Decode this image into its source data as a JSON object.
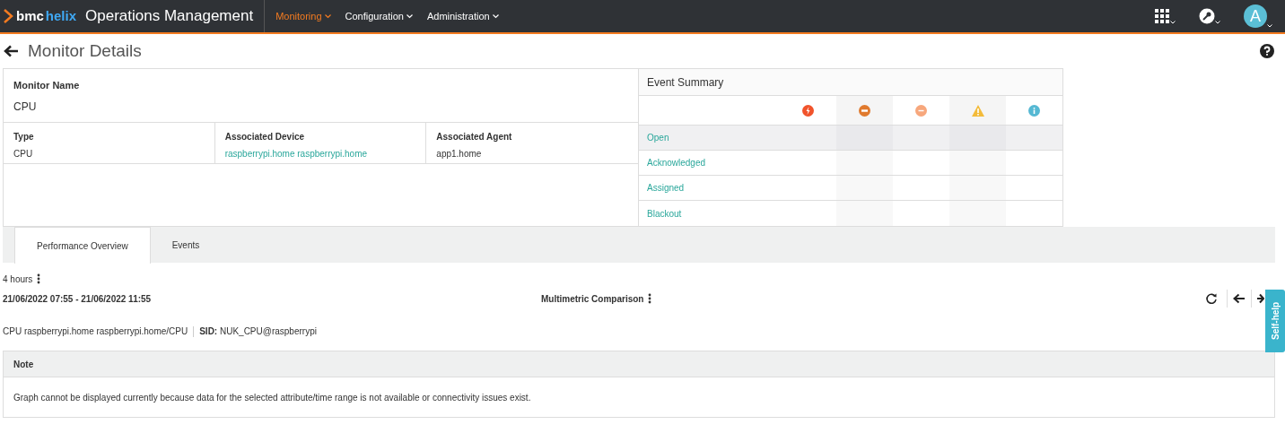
{
  "header": {
    "logo": {
      "brand": "bmc",
      "product": "helix"
    },
    "app_title": "Operations Management",
    "nav": [
      {
        "label": "Monitoring",
        "selected": true
      },
      {
        "label": "Configuration",
        "selected": false
      },
      {
        "label": "Administration",
        "selected": false
      }
    ],
    "avatar": "A"
  },
  "page_title": "Monitor Details",
  "monitor": {
    "name_label": "Monitor Name",
    "name": "CPU",
    "fields": [
      {
        "label": "Type",
        "value": "CPU",
        "kind": "text"
      },
      {
        "label": "Associated Device",
        "value": "raspberrypi.home raspberrypi.home",
        "kind": "link"
      },
      {
        "label": "Associated Agent",
        "value": "app1.home",
        "kind": "text"
      }
    ]
  },
  "event_summary": {
    "title": "Event Summary",
    "severities": [
      {
        "kind": "critical",
        "color": "#f1532b"
      },
      {
        "kind": "major",
        "color": "#e07a2e"
      },
      {
        "kind": "minor",
        "color": "#f7a77c"
      },
      {
        "kind": "warning",
        "color": "#f3bb3a"
      },
      {
        "kind": "info",
        "color": "#55b8d3"
      }
    ],
    "rows": [
      {
        "label": "Open",
        "selected": true
      },
      {
        "label": "Acknowledged",
        "selected": false
      },
      {
        "label": "Assigned",
        "selected": false
      },
      {
        "label": "Blackout",
        "selected": false
      }
    ]
  },
  "tabs": [
    {
      "label": "Performance Overview",
      "selected": true
    },
    {
      "label": "Events",
      "selected": false
    }
  ],
  "performance": {
    "range": "4 hours",
    "period": "21/06/2022 07:55 - 21/06/2022 11:55",
    "comparison": "Multimetric Comparison",
    "monitor_path": "CPU raspberrypi.home raspberrypi.home/CPU",
    "sid_label": "SID:",
    "sid": "NUK_CPU@raspberrypi",
    "note": {
      "title": "Note",
      "text": "Graph cannot be displayed currently because data for the selected attribute/time range is not available or connectivity issues exist."
    }
  },
  "self_help": "Self-help"
}
